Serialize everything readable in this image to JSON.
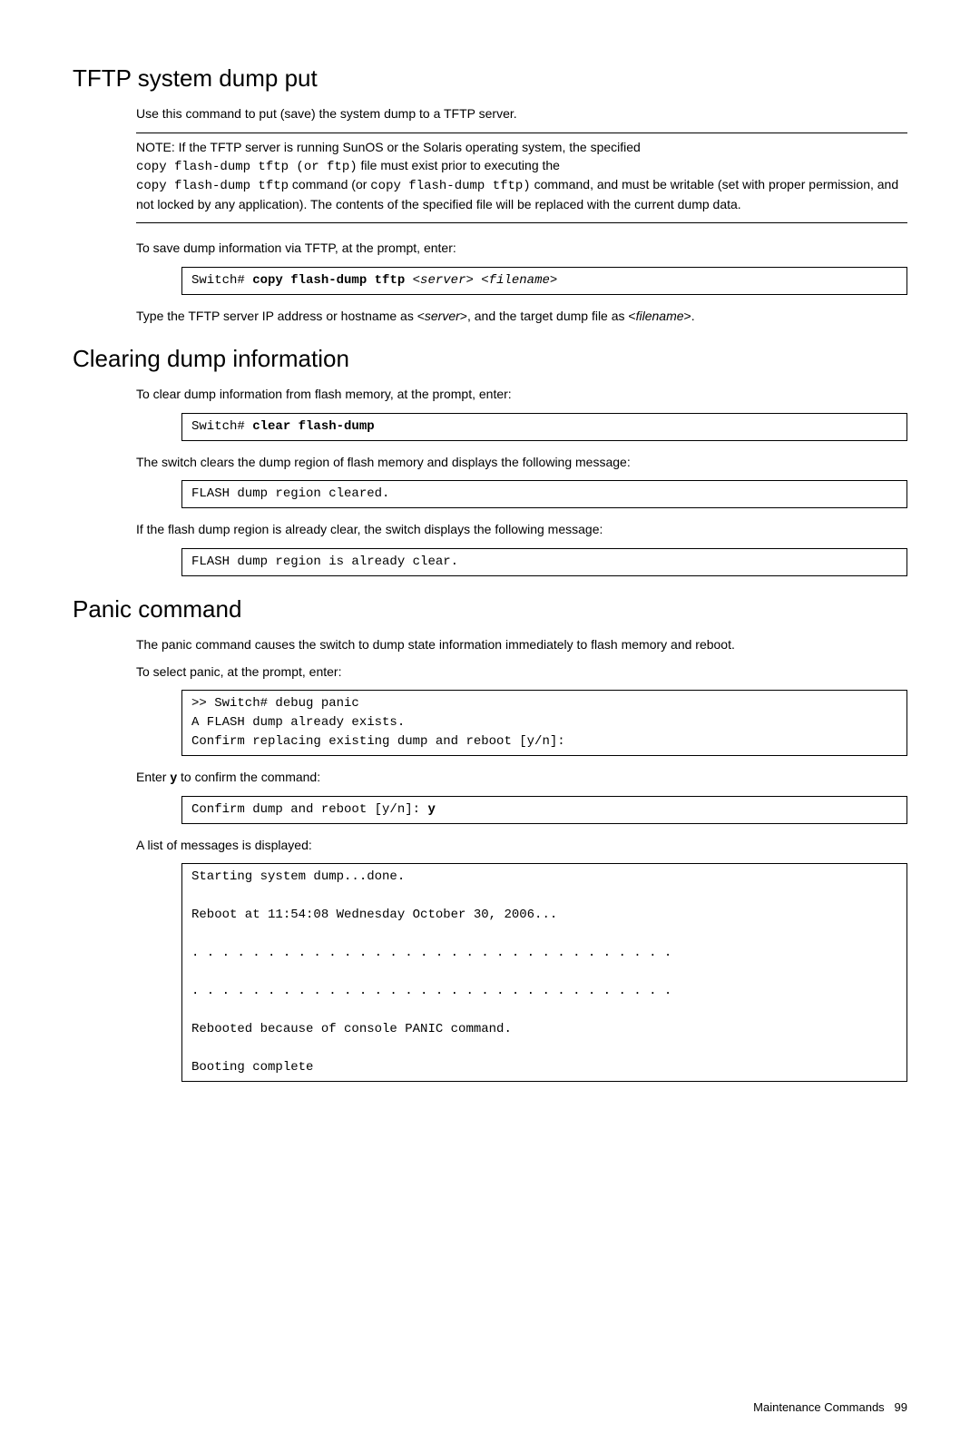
{
  "section1": {
    "heading": "TFTP system dump put",
    "intro": "Use this command to put (save) the system dump to a TFTP server.",
    "note_prefix": "NOTE:   If the TFTP server is running SunOS or the Solaris operating system, the specified",
    "note_code1": "copy flash-dump tftp (or ftp)",
    "note_mid1": "file must exist prior to executing the",
    "note_code2": "copy flash-dump tftp",
    "note_mid2": " command (or ",
    "note_code3": "copy flash-dump tftp)",
    "note_tail": " command, and must be writable (set with proper permission, and not locked by any application). The contents of the specified file will be replaced with the current dump data.",
    "para2": "To save dump information via TFTP, at the prompt, enter:",
    "code1_a": "Switch# ",
    "code1_b": "copy flash-dump tftp ",
    "code1_c": "<server> <filename>",
    "para3_a": "Type the TFTP server IP address or hostname as <",
    "para3_b": "server",
    "para3_c": ">, and the target dump file as <",
    "para3_d": "filename",
    "para3_e": ">."
  },
  "section2": {
    "heading": "Clearing dump information",
    "para1": "To clear dump information from flash memory, at the prompt, enter:",
    "code1_a": "Switch# ",
    "code1_b": "clear flash-dump",
    "para2": "The switch clears the dump region of flash memory and displays the following message:",
    "code2": "FLASH dump region cleared.",
    "para3": "If the flash dump region is already clear, the switch displays the following message:",
    "code3": "FLASH dump region is already clear."
  },
  "section3": {
    "heading": "Panic command",
    "para1": "The panic command causes the switch to dump state information immediately to flash memory and reboot.",
    "para2": "To select panic, at the prompt, enter:",
    "code1": ">> Switch# debug panic\nA FLASH dump already exists.\nConfirm replacing existing dump and reboot [y/n]:",
    "para3_a": "Enter ",
    "para3_b": "y",
    "para3_c": " to confirm the command:",
    "code2_a": "Confirm dump and reboot [y/n]: ",
    "code2_b": "y",
    "para4": "A list of messages is displayed:",
    "code3": "Starting system dump...done.\n\nReboot at 11:54:08 Wednesday October 30, 2006...\n\n. . . . . . . . . . . . . . . . . . . . . . . . . . . . . . . .\n\n. . . . . . . . . . . . . . . . . . . . . . . . . . . . . . . .\n\nRebooted because of console PANIC command.\n\nBooting complete"
  },
  "footer": {
    "label": "Maintenance Commands",
    "page": "99"
  }
}
